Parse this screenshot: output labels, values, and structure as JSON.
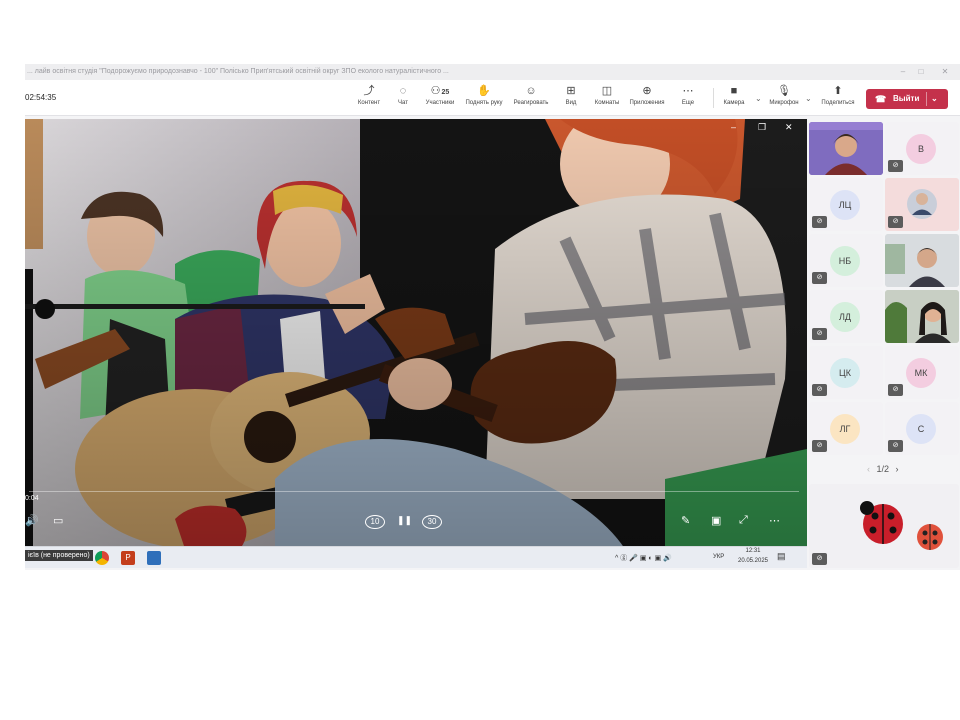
{
  "window": {
    "title": "... лайв освітня студія \"Подорожуємо природознавчо - 100\" Полісько Прип'ятський освітній округ ЗПО еколого натуралістичного ...",
    "minimize": "–",
    "maximize": "□",
    "close": "✕"
  },
  "toolbar": {
    "timer": "02:54:35",
    "buttons": [
      {
        "icon": "share-icon",
        "glyph": "⤴",
        "label": "Контент"
      },
      {
        "icon": "chat-icon",
        "glyph": "◌",
        "label": "Чат"
      },
      {
        "icon": "people-icon",
        "glyph": "⚇",
        "label": "Участники",
        "count": "25"
      },
      {
        "icon": "raise-hand-icon",
        "glyph": "✋",
        "label": "Поднять руку"
      },
      {
        "icon": "react-icon",
        "glyph": "☺",
        "label": "Реагировать"
      },
      {
        "icon": "view-icon",
        "glyph": "⊞",
        "label": "Вид"
      },
      {
        "icon": "rooms-icon",
        "glyph": "◫",
        "label": "Комнаты"
      },
      {
        "icon": "apps-icon",
        "glyph": "⊕",
        "label": "Приложения"
      },
      {
        "icon": "more-icon",
        "glyph": "⋯",
        "label": "Еще"
      },
      {
        "icon": "camera-off-icon",
        "glyph": "■",
        "label": "Камера"
      },
      {
        "icon": "mic-off-icon",
        "glyph": "🎙",
        "label": "Микрофон"
      },
      {
        "icon": "share-screen-icon",
        "glyph": "⬆",
        "label": "Поделиться"
      }
    ],
    "leave_label": "Выйти",
    "leave_glyph": "☎",
    "dropdown_glyph": "⌄"
  },
  "video": {
    "elapsed": "0:04",
    "popout_min": "–",
    "popout_restore": "❐",
    "popout_close": "✕",
    "rewind": "10",
    "forward": "30",
    "pause": "❚❚",
    "volume": "🔊",
    "captions": "▭",
    "edit": "✎",
    "miniplayer": "▣",
    "fullscreen": "⤢",
    "more": "⋯"
  },
  "taskbar": {
    "app_label": "ієїв (не проверено)",
    "tray": "^ ⓖ 🎤 ▣ ◐ ▣ 🔊",
    "language": "УКР",
    "time": "12:31",
    "date": "20.05.2025",
    "notification": "▤"
  },
  "participants": [
    {
      "initials": "",
      "photo": true
    },
    {
      "initials": "В",
      "color": "#f3cde0"
    },
    {
      "initials": "ЛЦ",
      "color": "#dde3f6"
    },
    {
      "initials": "",
      "photo": true
    },
    {
      "initials": "НБ",
      "color": "#d4efdc"
    },
    {
      "initials": "",
      "photo": true
    },
    {
      "initials": "ЛД",
      "color": "#d4efdc"
    },
    {
      "initials": "",
      "photo": true
    },
    {
      "initials": "ЦК",
      "color": "#d5ecef"
    },
    {
      "initials": "МК",
      "color": "#f3cde0"
    },
    {
      "initials": "ЛГ",
      "color": "#fbe5c2"
    },
    {
      "initials": "С",
      "color": "#dde3f6"
    }
  ],
  "pager": {
    "prev": "‹",
    "text": "1/2",
    "next": "›"
  },
  "colors": {
    "leave": "#c4314b",
    "accent": "#6264a7"
  }
}
